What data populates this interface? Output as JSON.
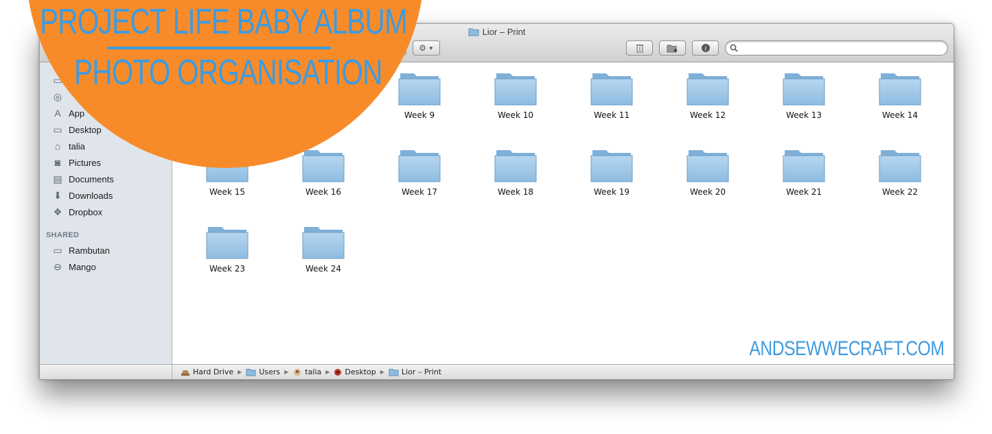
{
  "window": {
    "title": "Lior – Print",
    "search_placeholder": ""
  },
  "toolbar": {
    "delete_icon": "trash-icon",
    "new_folder_icon": "new-folder-icon",
    "info_icon": "info-icon",
    "action_icon": "gear-icon",
    "share_icon": "share-icon"
  },
  "sidebar": {
    "favorites": [
      {
        "label": "App",
        "icon": "applications-icon"
      },
      {
        "label": "Desktop",
        "icon": "desktop-icon"
      },
      {
        "label": "talia",
        "icon": "home-icon"
      },
      {
        "label": "Pictures",
        "icon": "camera-icon"
      },
      {
        "label": "Documents",
        "icon": "documents-icon"
      },
      {
        "label": "Downloads",
        "icon": "download-icon"
      },
      {
        "label": "Dropbox",
        "icon": "dropbox-icon"
      }
    ],
    "shared_heading": "SHARED",
    "shared": [
      {
        "label": "Rambutan",
        "icon": "computer-icon"
      },
      {
        "label": "Mango",
        "icon": "drive-icon"
      }
    ]
  },
  "folders": [
    "Week 9",
    "Week 10",
    "Week 11",
    "Week 12",
    "Week 13",
    "Week 14",
    "Week 15",
    "Week 16",
    "Week 17",
    "Week 18",
    "Week 19",
    "Week 20",
    "Week 21",
    "Week 22",
    "Week 23",
    "Week 24"
  ],
  "pathbar": [
    {
      "label": "Hard Drive",
      "icon": "hard-drive-icon"
    },
    {
      "label": "Users",
      "icon": "folder-icon"
    },
    {
      "label": "talia",
      "icon": "home-icon"
    },
    {
      "label": "Desktop",
      "icon": "desktop-icon"
    },
    {
      "label": "Lior – Print",
      "icon": "folder-icon"
    }
  ],
  "overlay": {
    "line1": "PROJECT LIFE BABY ALBUM",
    "line2": "PHOTO ORGANISATION",
    "watermark": "ANDSEWWECRAFT.COM"
  },
  "colors": {
    "accent_orange": "#f88b29",
    "accent_blue": "#3e9be0",
    "folder_blue": "#8fbde0"
  }
}
